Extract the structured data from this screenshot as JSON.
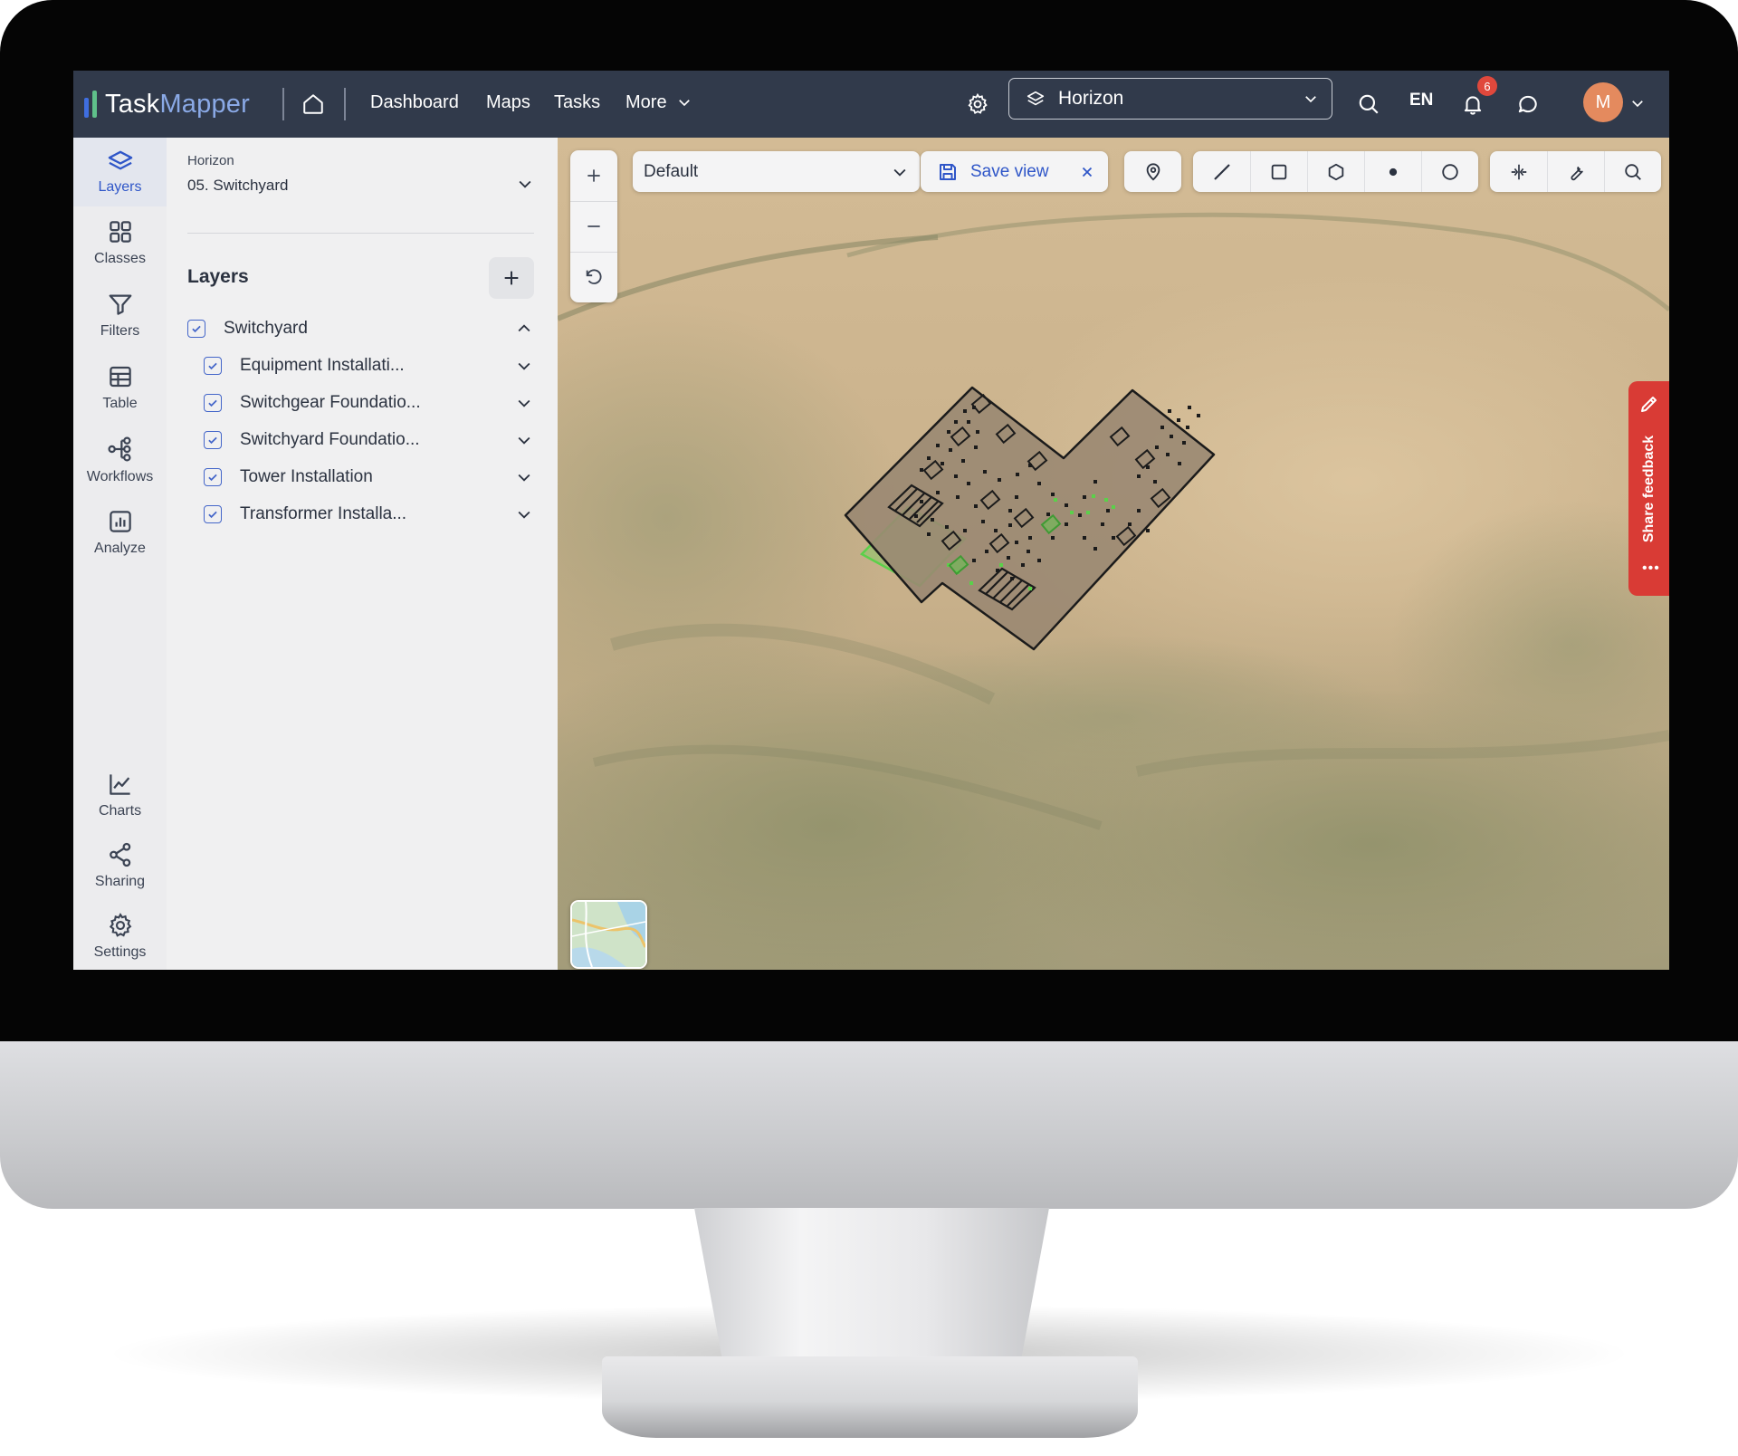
{
  "app": {
    "logo_part1": "Task",
    "logo_part2": "Mapper"
  },
  "topbar": {
    "nav": [
      "Dashboard",
      "Maps",
      "Tasks",
      "More"
    ],
    "project": "Horizon",
    "language": "EN",
    "notification_count": "6",
    "avatar_initial": "M"
  },
  "rail": {
    "items": [
      {
        "label": "Layers",
        "icon": "layers-icon",
        "active": true
      },
      {
        "label": "Classes",
        "icon": "grid-icon"
      },
      {
        "label": "Filters",
        "icon": "filter-icon"
      },
      {
        "label": "Table",
        "icon": "table-icon"
      },
      {
        "label": "Workflows",
        "icon": "workflow-icon"
      },
      {
        "label": "Analyze",
        "icon": "bar-chart-icon"
      }
    ],
    "bottom_items": [
      {
        "label": "Charts",
        "icon": "line-chart-icon"
      },
      {
        "label": "Sharing",
        "icon": "share-icon"
      },
      {
        "label": "Settings",
        "icon": "settings-icon"
      }
    ]
  },
  "panel": {
    "project_name": "Horizon",
    "project_sub": "05. Switchyard",
    "title": "Layers",
    "group": {
      "label": "Switchyard",
      "checked": true,
      "expanded": true
    },
    "layers": [
      {
        "label": "Equipment Installati...",
        "checked": true
      },
      {
        "label": "Switchgear Foundatio...",
        "checked": true
      },
      {
        "label": "Switchyard Foundatio...",
        "checked": true
      },
      {
        "label": "Tower Installation",
        "checked": true
      },
      {
        "label": "Transformer Installa...",
        "checked": true
      }
    ]
  },
  "map": {
    "view": "Default",
    "save_view_label": "Save view",
    "feedback_label": "Share feedback",
    "feedback_dots": "•••",
    "colors": {
      "ground": "#cdb48f",
      "site_fill": "#9a8872",
      "highlight": "#5bd04a"
    }
  },
  "colors": {
    "topbar": "#313a4b",
    "accent": "#2f56c8",
    "badge": "#e0483c",
    "avatar": "#e48a5e",
    "feedback": "#d93b35"
  }
}
